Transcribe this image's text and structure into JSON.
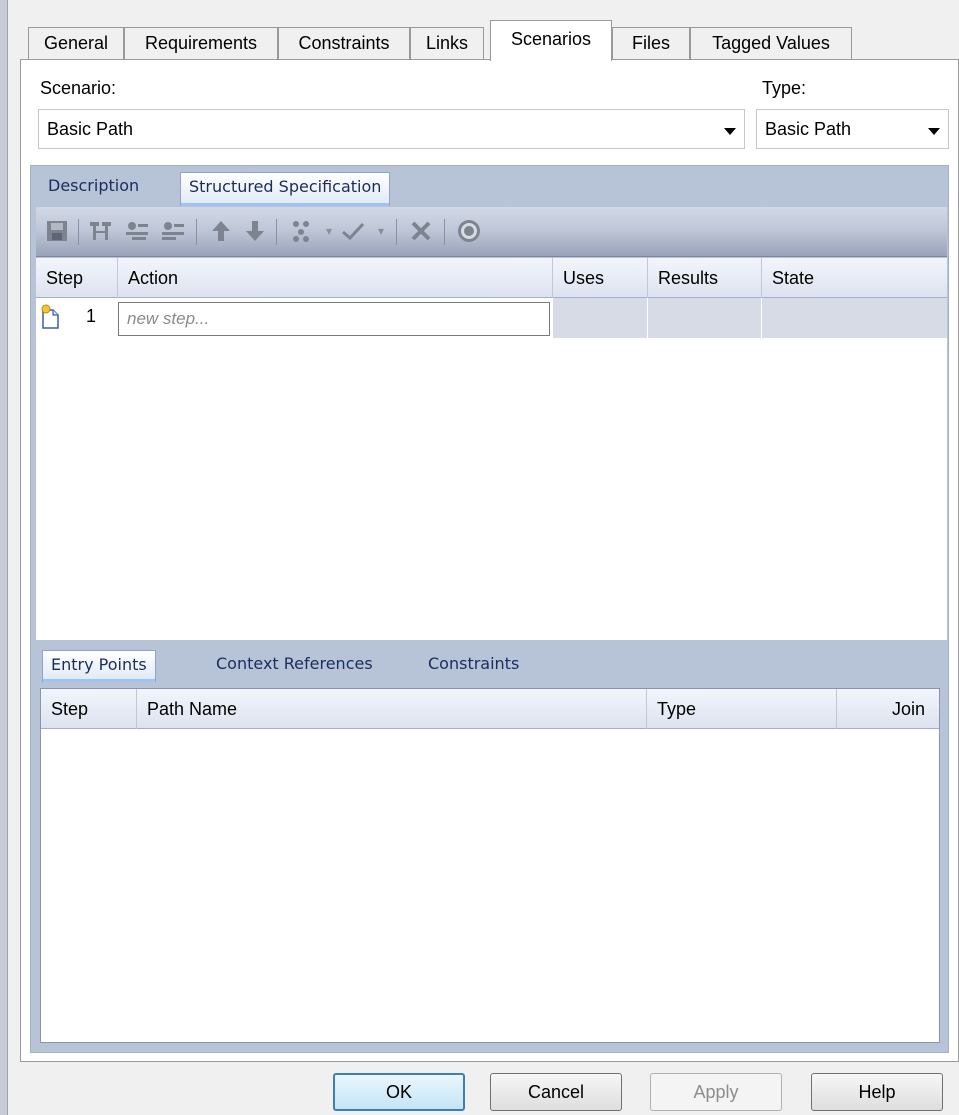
{
  "tabs": [
    {
      "label": "General",
      "active": false
    },
    {
      "label": "Requirements",
      "active": false
    },
    {
      "label": "Constraints",
      "active": false
    },
    {
      "label": "Links",
      "active": false
    },
    {
      "label": "Scenarios",
      "active": true
    },
    {
      "label": "Files",
      "active": false
    },
    {
      "label": "Tagged Values",
      "active": false
    }
  ],
  "scenario": {
    "label": "Scenario:",
    "value": "Basic Path"
  },
  "type": {
    "label": "Type:",
    "value": "Basic Path"
  },
  "subtabs": [
    {
      "label": "Description",
      "active": false
    },
    {
      "label": "Structured Specification",
      "active": true
    }
  ],
  "toolbar": {
    "icons": [
      "save-icon",
      "insert-step-icon",
      "indent-icon",
      "outdent-icon",
      "move-up-icon",
      "move-down-icon",
      "generate-icon",
      "validate-icon",
      "delete-icon",
      "help-icon"
    ]
  },
  "steps_grid": {
    "columns": [
      "Step",
      "Action",
      "Uses",
      "Results",
      "State"
    ],
    "new_row": {
      "step": "1",
      "placeholder": "new step..."
    }
  },
  "bottom_tabs": [
    {
      "label": "Entry Points",
      "active": true
    },
    {
      "label": "Context References",
      "active": false
    },
    {
      "label": "Constraints",
      "active": false
    }
  ],
  "entry_grid": {
    "columns": [
      "Step",
      "Path Name",
      "Type",
      "Join"
    ]
  },
  "buttons": {
    "ok": "OK",
    "cancel": "Cancel",
    "apply": "Apply",
    "help": "Help"
  }
}
